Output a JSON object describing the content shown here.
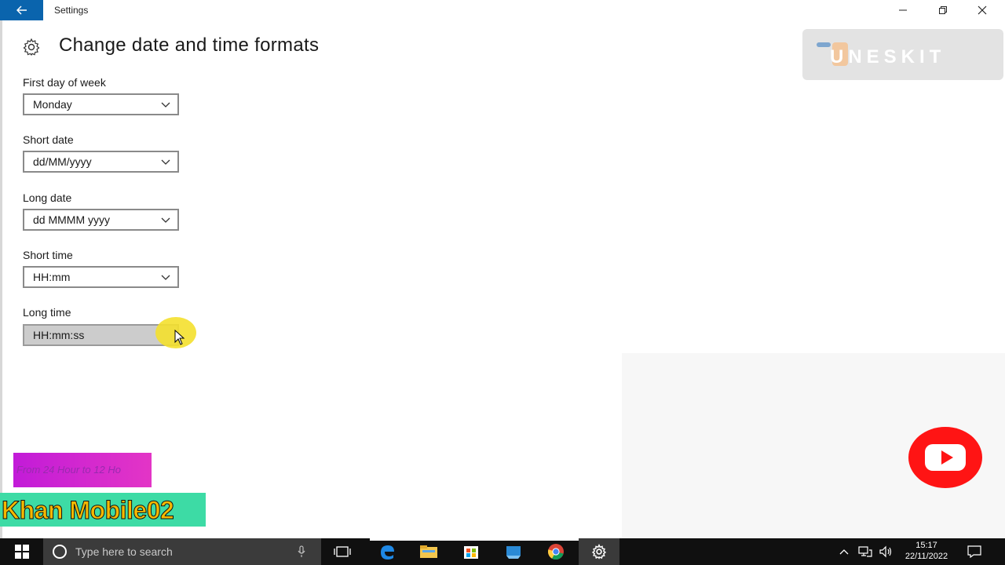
{
  "window": {
    "app_title": "Settings",
    "back_icon": "arrow-left-icon",
    "controls": [
      "minimize-icon",
      "maximize-icon",
      "close-icon"
    ]
  },
  "header": {
    "icon": "gear-icon",
    "title": "Change date and time formats"
  },
  "fields": [
    {
      "label": "First day of week",
      "value": "Monday"
    },
    {
      "label": "Short date",
      "value": "dd/MM/yyyy"
    },
    {
      "label": "Long date",
      "value": "dd MMMM yyyy"
    },
    {
      "label": "Short time",
      "value": "HH:mm"
    },
    {
      "label": "Long time",
      "value": "HH:mm:ss"
    }
  ],
  "watermark": {
    "text": "UNESKIT"
  },
  "overlays": {
    "pink_banner": "From 24 Hour to 12 Ho",
    "channel_name": "Khan Mobile02",
    "youtube_icon": "youtube-play-icon"
  },
  "taskbar": {
    "search_placeholder": "Type here to search",
    "pinned": [
      "task-view-icon",
      "edge-icon",
      "file-explorer-icon",
      "store-icon",
      "app-icon",
      "chrome-icon",
      "settings-icon"
    ],
    "clock_time": "15:17",
    "clock_date": "22/11/2022"
  },
  "colors": {
    "accent": "#0a64ad",
    "hover_dropdown": "#cccccc",
    "cursor_highlight": "#f4e02d",
    "youtube_red": "#ff1414"
  }
}
